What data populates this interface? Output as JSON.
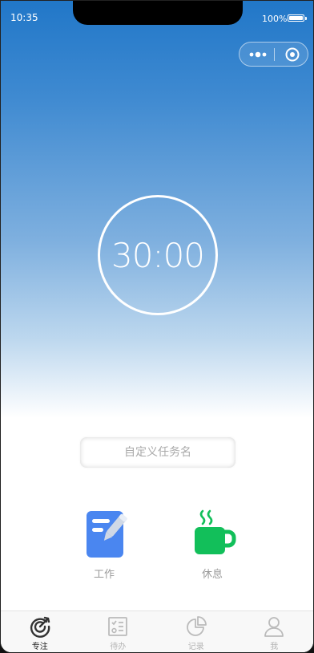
{
  "status_bar": {
    "time": "10:35",
    "battery": "100%"
  },
  "capsule": {
    "more_icon": "more-dots-icon",
    "close_icon": "target-close-icon"
  },
  "timer": {
    "display": "30:00"
  },
  "task": {
    "placeholder": "自定义任务名",
    "value": ""
  },
  "modes": [
    {
      "label": "工作",
      "icon": "edit-note-icon",
      "color": "#4a86f0"
    },
    {
      "label": "休息",
      "icon": "coffee-cup-icon",
      "color": "#12bf5a"
    }
  ],
  "tabbar": {
    "items": [
      {
        "label": "专注",
        "icon": "focus-target-icon",
        "active": true
      },
      {
        "label": "待办",
        "icon": "checklist-icon",
        "active": false
      },
      {
        "label": "记录",
        "icon": "pie-chart-icon",
        "active": false
      },
      {
        "label": "我",
        "icon": "user-icon",
        "active": false
      }
    ]
  }
}
